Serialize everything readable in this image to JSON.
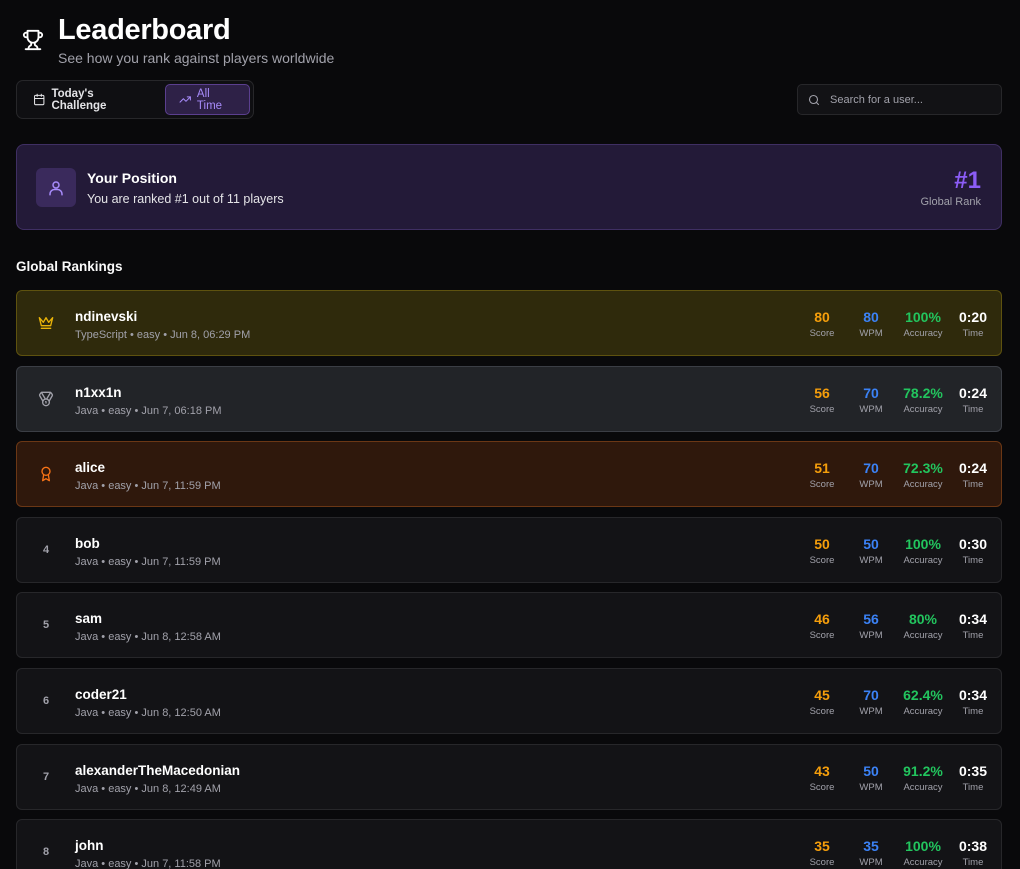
{
  "header": {
    "title": "Leaderboard",
    "subtitle": "See how you rank against players worldwide"
  },
  "tabs": [
    {
      "label": "Today's Challenge",
      "icon": "calendar-icon",
      "active": false
    },
    {
      "label": "All Time",
      "icon": "trending-up-icon",
      "active": true
    }
  ],
  "search": {
    "placeholder": "Search for a user..."
  },
  "position": {
    "title": "Your Position",
    "text": "You are ranked #1 out of 11 players",
    "rank": "#1",
    "rank_label": "Global Rank"
  },
  "section_title": "Global Rankings",
  "stat_labels": {
    "score": "Score",
    "wpm": "WPM",
    "accuracy": "Accuracy",
    "time": "Time"
  },
  "colors": {
    "accent": "#8b5cf6",
    "score": "#f59e0b",
    "wpm": "#3b82f6",
    "accuracy": "#22c55e"
  },
  "rankings": [
    {
      "rank": "1",
      "badge": "crown-icon",
      "name": "ndinevski",
      "meta": "TypeScript • easy • Jun 8, 06:29 PM",
      "score": "80",
      "wpm": "80",
      "accuracy": "100%",
      "time": "0:20"
    },
    {
      "rank": "2",
      "badge": "medal-icon",
      "name": "n1xx1n",
      "meta": "Java • easy • Jun 7, 06:18 PM",
      "score": "56",
      "wpm": "70",
      "accuracy": "78.2%",
      "time": "0:24"
    },
    {
      "rank": "3",
      "badge": "award-icon",
      "name": "alice",
      "meta": "Java • easy • Jun 7, 11:59 PM",
      "score": "51",
      "wpm": "70",
      "accuracy": "72.3%",
      "time": "0:24"
    },
    {
      "rank": "4",
      "name": "bob",
      "meta": "Java • easy • Jun 7, 11:59 PM",
      "score": "50",
      "wpm": "50",
      "accuracy": "100%",
      "time": "0:30"
    },
    {
      "rank": "5",
      "name": "sam",
      "meta": "Java • easy • Jun 8, 12:58 AM",
      "score": "46",
      "wpm": "56",
      "accuracy": "80%",
      "time": "0:34"
    },
    {
      "rank": "6",
      "name": "coder21",
      "meta": "Java • easy • Jun 8, 12:50 AM",
      "score": "45",
      "wpm": "70",
      "accuracy": "62.4%",
      "time": "0:34"
    },
    {
      "rank": "7",
      "name": "alexanderTheMacedonian",
      "meta": "Java • easy • Jun 8, 12:49 AM",
      "score": "43",
      "wpm": "50",
      "accuracy": "91.2%",
      "time": "0:35"
    },
    {
      "rank": "8",
      "name": "john",
      "meta": "Java • easy • Jun 7, 11:58 PM",
      "score": "35",
      "wpm": "35",
      "accuracy": "100%",
      "time": "0:38"
    }
  ]
}
